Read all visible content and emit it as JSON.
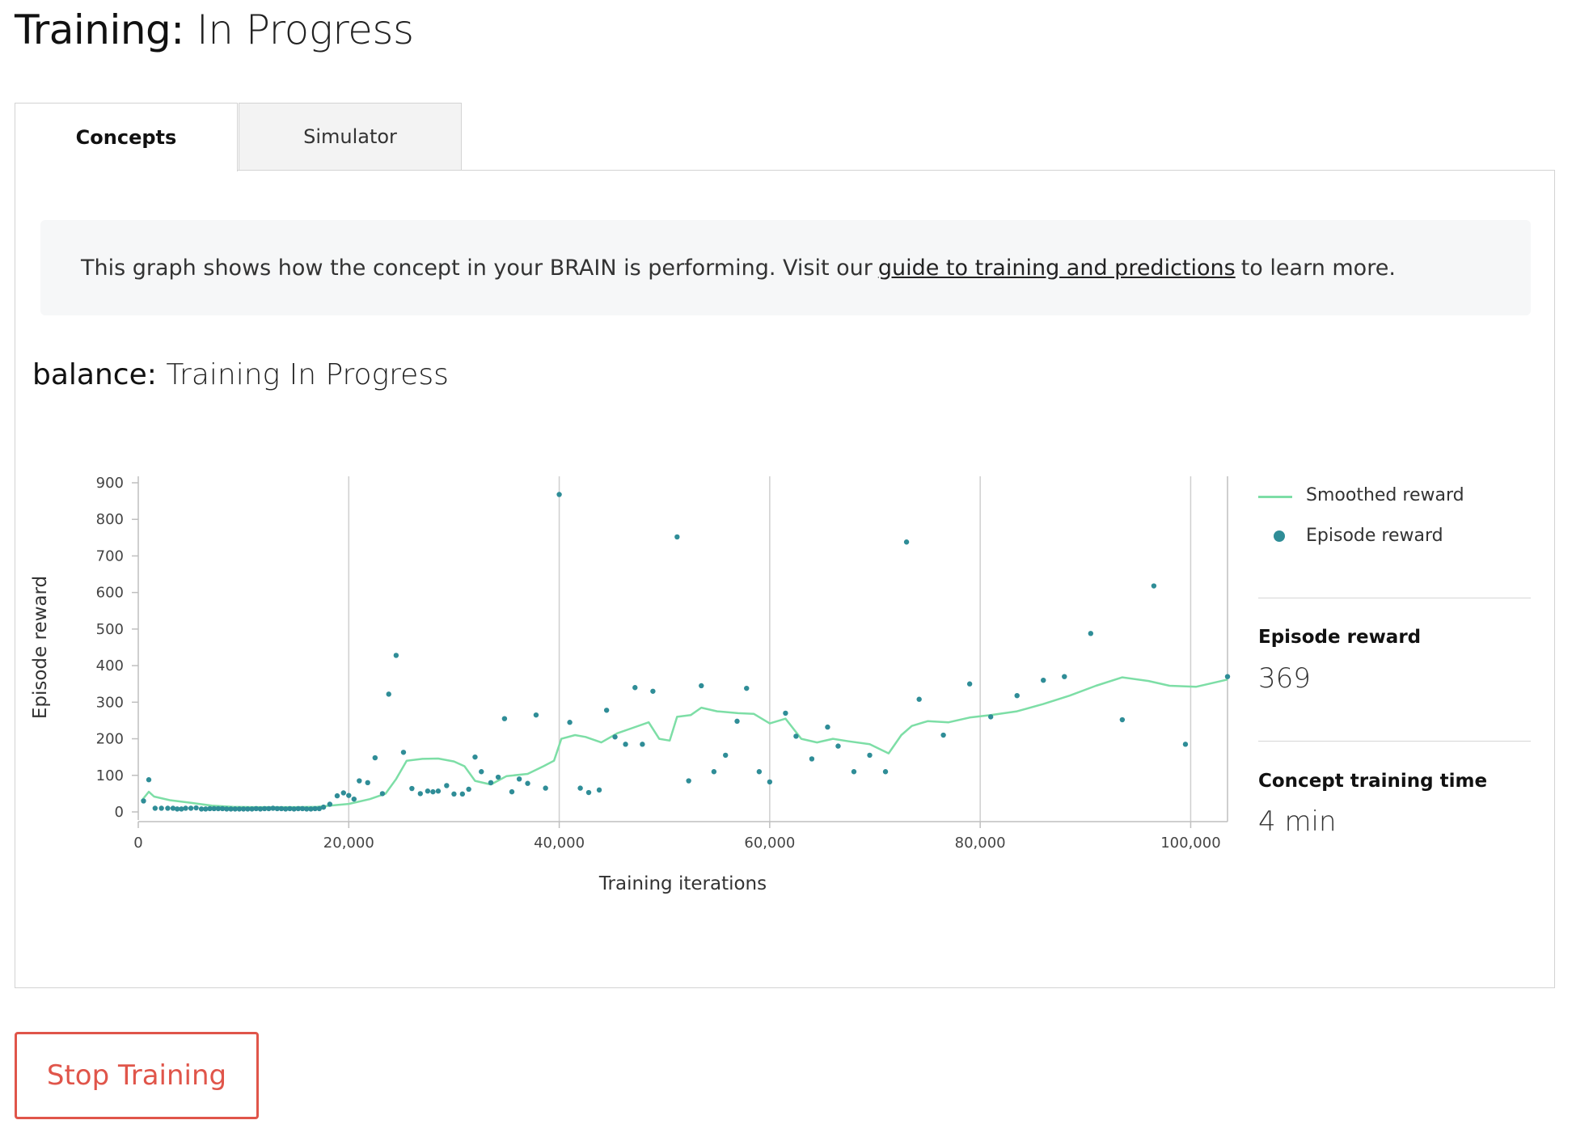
{
  "page": {
    "title_label": "Training:",
    "title_value": "In Progress"
  },
  "tabs": [
    {
      "label": "Concepts",
      "active": true
    },
    {
      "label": "Simulator",
      "active": false
    }
  ],
  "info": {
    "text_before": "This graph shows how the concept in your BRAIN is performing. Visit our",
    "link_text": "guide to training and predictions",
    "text_after": "to learn more."
  },
  "concept": {
    "name": "balance:",
    "status": "Training In Progress"
  },
  "legend": {
    "smoothed": "Smoothed reward",
    "episode": "Episode reward"
  },
  "stats": {
    "episode_reward_label": "Episode reward",
    "episode_reward_value": "369",
    "training_time_label": "Concept training time",
    "training_time_value": "4 min"
  },
  "buttons": {
    "stop": "Stop Training"
  },
  "colors": {
    "smoothed": "#7ddea6",
    "episode": "#2f8d97",
    "stop": "#e0554a"
  },
  "chart_data": {
    "type": "scatter",
    "xlabel": "Training iterations",
    "ylabel": "Episode reward",
    "xlim": [
      0,
      103500
    ],
    "ylim": [
      0,
      900
    ],
    "xticks": [
      0,
      20000,
      40000,
      60000,
      80000,
      100000
    ],
    "xtick_labels": [
      "0",
      "20,000",
      "40,000",
      "60,000",
      "80,000",
      "100,000"
    ],
    "yticks": [
      0,
      100,
      200,
      300,
      400,
      500,
      600,
      700,
      800,
      900
    ],
    "ytick_labels": [
      "0",
      "100",
      "200",
      "300",
      "400",
      "500",
      "600",
      "700",
      "800",
      "900"
    ],
    "vertical_gridlines": [
      20000,
      40000,
      60000,
      80000,
      100000
    ],
    "legend_position": "right",
    "series": [
      {
        "name": "Smoothed reward",
        "type": "line",
        "points": [
          [
            300,
            30
          ],
          [
            1000,
            55
          ],
          [
            1500,
            42
          ],
          [
            3000,
            32
          ],
          [
            5000,
            25
          ],
          [
            7000,
            17
          ],
          [
            9000,
            14
          ],
          [
            11000,
            13
          ],
          [
            13000,
            13
          ],
          [
            15000,
            13
          ],
          [
            17000,
            14
          ],
          [
            18500,
            18
          ],
          [
            20000,
            22
          ],
          [
            22000,
            35
          ],
          [
            23500,
            50
          ],
          [
            24500,
            90
          ],
          [
            25500,
            140
          ],
          [
            27000,
            145
          ],
          [
            28500,
            146
          ],
          [
            30000,
            138
          ],
          [
            31000,
            125
          ],
          [
            32000,
            85
          ],
          [
            33500,
            75
          ],
          [
            35000,
            98
          ],
          [
            37000,
            104
          ],
          [
            38500,
            125
          ],
          [
            39500,
            140
          ],
          [
            40200,
            200
          ],
          [
            41500,
            210
          ],
          [
            42500,
            205
          ],
          [
            44000,
            190
          ],
          [
            45500,
            215
          ],
          [
            47000,
            230
          ],
          [
            48500,
            245
          ],
          [
            49500,
            200
          ],
          [
            50500,
            195
          ],
          [
            51200,
            260
          ],
          [
            52500,
            265
          ],
          [
            53500,
            285
          ],
          [
            55000,
            275
          ],
          [
            57000,
            270
          ],
          [
            58500,
            268
          ],
          [
            60000,
            242
          ],
          [
            61500,
            255
          ],
          [
            63000,
            200
          ],
          [
            64500,
            190
          ],
          [
            66000,
            200
          ],
          [
            67500,
            193
          ],
          [
            69500,
            185
          ],
          [
            71300,
            160
          ],
          [
            72500,
            210
          ],
          [
            73500,
            235
          ],
          [
            75000,
            248
          ],
          [
            77000,
            245
          ],
          [
            79000,
            258
          ],
          [
            81000,
            265
          ],
          [
            83500,
            275
          ],
          [
            86000,
            295
          ],
          [
            88500,
            318
          ],
          [
            91000,
            345
          ],
          [
            93500,
            368
          ],
          [
            96000,
            358
          ],
          [
            98000,
            345
          ],
          [
            100500,
            342
          ],
          [
            103500,
            362
          ]
        ]
      },
      {
        "name": "Episode reward",
        "type": "scatter",
        "points": [
          [
            500,
            30
          ],
          [
            1000,
            88
          ],
          [
            1600,
            10
          ],
          [
            2200,
            10
          ],
          [
            2800,
            10
          ],
          [
            3300,
            10
          ],
          [
            3700,
            8
          ],
          [
            4100,
            8
          ],
          [
            4500,
            10
          ],
          [
            5000,
            10
          ],
          [
            5500,
            11
          ],
          [
            6000,
            8
          ],
          [
            6400,
            8
          ],
          [
            6800,
            9
          ],
          [
            7200,
            9
          ],
          [
            7600,
            9
          ],
          [
            8000,
            9
          ],
          [
            8400,
            8
          ],
          [
            8800,
            8
          ],
          [
            9200,
            8
          ],
          [
            9600,
            8
          ],
          [
            10000,
            8
          ],
          [
            10400,
            8
          ],
          [
            10800,
            8
          ],
          [
            11200,
            9
          ],
          [
            11600,
            8
          ],
          [
            12000,
            9
          ],
          [
            12400,
            9
          ],
          [
            12800,
            10
          ],
          [
            13200,
            9
          ],
          [
            13600,
            9
          ],
          [
            14000,
            8
          ],
          [
            14400,
            9
          ],
          [
            14800,
            8
          ],
          [
            15200,
            9
          ],
          [
            15600,
            9
          ],
          [
            16000,
            8
          ],
          [
            16400,
            8
          ],
          [
            16800,
            9
          ],
          [
            17200,
            9
          ],
          [
            17600,
            13
          ],
          [
            18200,
            21
          ],
          [
            18900,
            44
          ],
          [
            19500,
            52
          ],
          [
            20000,
            45
          ],
          [
            20500,
            35
          ],
          [
            21000,
            85
          ],
          [
            21800,
            80
          ],
          [
            22500,
            148
          ],
          [
            23200,
            50
          ],
          [
            23800,
            322
          ],
          [
            24500,
            428
          ],
          [
            25200,
            163
          ],
          [
            26000,
            64
          ],
          [
            26800,
            50
          ],
          [
            27500,
            57
          ],
          [
            28000,
            55
          ],
          [
            28500,
            57
          ],
          [
            29300,
            72
          ],
          [
            30000,
            49
          ],
          [
            30800,
            49
          ],
          [
            31400,
            62
          ],
          [
            32000,
            150
          ],
          [
            32600,
            110
          ],
          [
            33500,
            80
          ],
          [
            34200,
            95
          ],
          [
            34800,
            255
          ],
          [
            35500,
            55
          ],
          [
            36200,
            90
          ],
          [
            37000,
            78
          ],
          [
            37800,
            265
          ],
          [
            38700,
            65
          ],
          [
            40000,
            868
          ],
          [
            41000,
            245
          ],
          [
            42000,
            65
          ],
          [
            42800,
            53
          ],
          [
            43800,
            60
          ],
          [
            44500,
            278
          ],
          [
            45300,
            205
          ],
          [
            46300,
            185
          ],
          [
            47200,
            340
          ],
          [
            47900,
            185
          ],
          [
            48900,
            330
          ],
          [
            51200,
            752
          ],
          [
            52300,
            85
          ],
          [
            53500,
            345
          ],
          [
            54700,
            110
          ],
          [
            55800,
            155
          ],
          [
            56900,
            248
          ],
          [
            57800,
            338
          ],
          [
            59000,
            110
          ],
          [
            60000,
            82
          ],
          [
            61500,
            270
          ],
          [
            62500,
            207
          ],
          [
            64000,
            145
          ],
          [
            65500,
            232
          ],
          [
            66500,
            180
          ],
          [
            68000,
            110
          ],
          [
            69500,
            155
          ],
          [
            71000,
            110
          ],
          [
            73000,
            738
          ],
          [
            74200,
            308
          ],
          [
            76500,
            210
          ],
          [
            79000,
            350
          ],
          [
            81000,
            260
          ],
          [
            83500,
            318
          ],
          [
            86000,
            360
          ],
          [
            88000,
            370
          ],
          [
            90500,
            488
          ],
          [
            93500,
            252
          ],
          [
            96500,
            618
          ],
          [
            99500,
            185
          ],
          [
            103500,
            370
          ]
        ]
      }
    ]
  }
}
